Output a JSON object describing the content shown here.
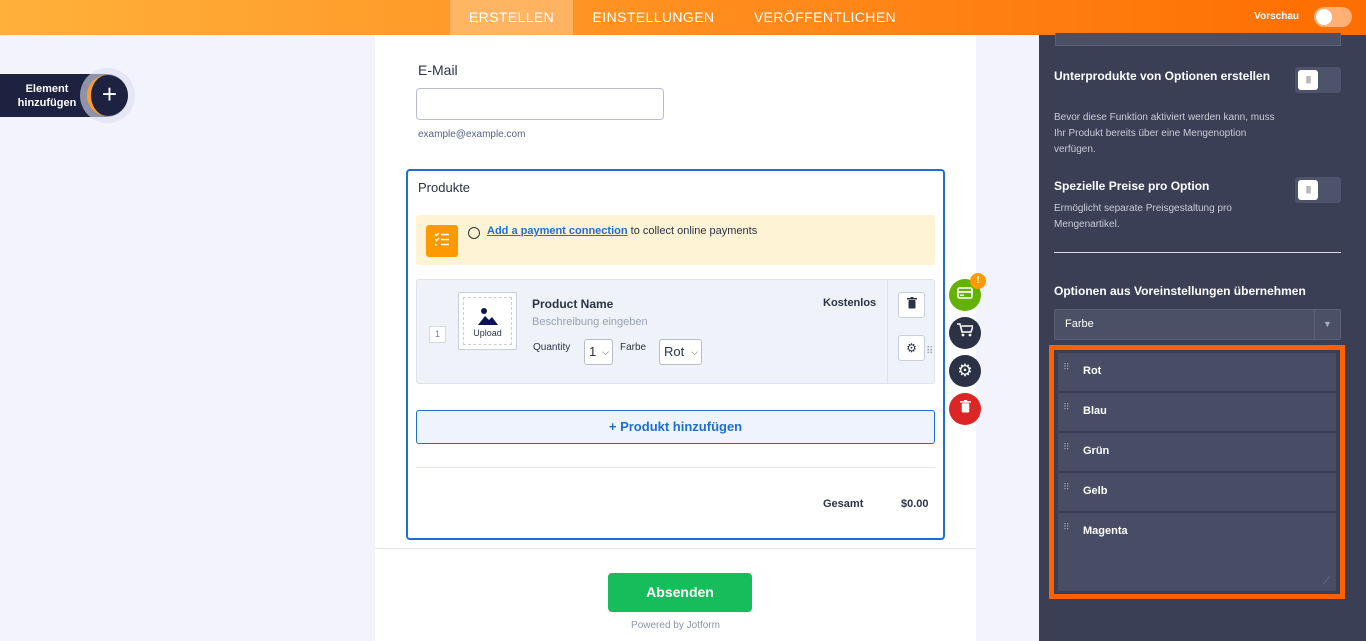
{
  "topbar": {
    "tabs": [
      {
        "label": "ERSTELLEN",
        "active": true
      },
      {
        "label": "EINSTELLUNGEN",
        "active": false
      },
      {
        "label": "VERÖFFENTLICHEN",
        "active": false
      }
    ],
    "preview_label": "Vorschau"
  },
  "sidebar": {
    "add_element_label": "Element hinzufügen"
  },
  "form": {
    "email_label": "E-Mail",
    "email_value": "",
    "email_hint": "example@example.com",
    "products_title": "Produkte",
    "payment_banner": {
      "link_text": "Add a payment connection",
      "text": "to collect online payments"
    },
    "product": {
      "index": "1",
      "upload_label": "Upload",
      "name": "Product Name",
      "description_placeholder": "Beschreibung eingeben",
      "price": "Kostenlos",
      "quantity_label": "Quantity",
      "quantity_value": "1",
      "color_label": "Farbe",
      "color_value": "Rot"
    },
    "add_product_label": "+ Produkt hinzufügen",
    "total_label": "Gesamt",
    "total_value": "$0.00",
    "submit_label": "Absenden",
    "powered_by": "Powered by Jotform"
  },
  "fab": {
    "badge": "!"
  },
  "panel": {
    "sub_products": {
      "title": "Unterprodukte von Optionen erstellen",
      "description": "Bevor diese Funktion aktiviert werden kann, muss Ihr Produkt bereits über eine Mengenoption verfügen."
    },
    "special_prices": {
      "title": "Spezielle Preise pro Option",
      "description": "Ermöglicht separate Preisgestaltung pro Mengenartikel."
    },
    "preset_title": "Optionen aus Voreinstellungen übernehmen",
    "preset_value": "Farbe",
    "options": [
      "Rot",
      "Blau",
      "Grün",
      "Gelb",
      "Magenta"
    ]
  },
  "colors": {
    "accent_orange": "#ff6100",
    "submit_green": "#18bd5b",
    "panel_bg": "#3a3f55",
    "link_blue": "#1f6fd1"
  }
}
